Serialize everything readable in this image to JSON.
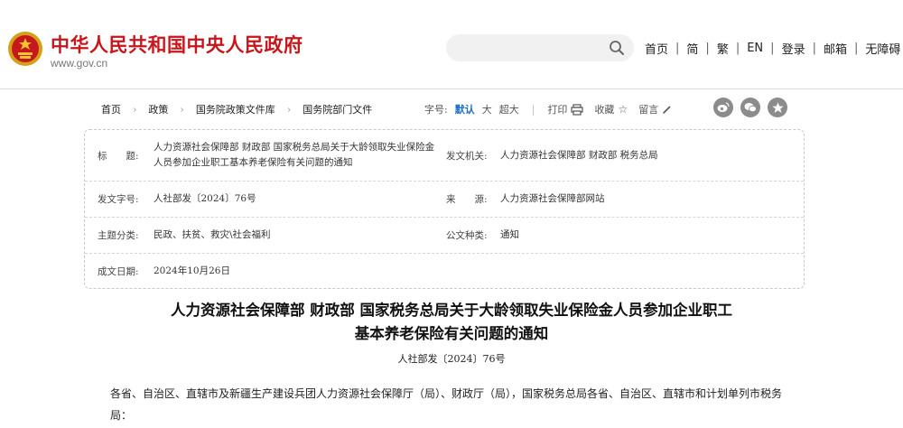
{
  "header": {
    "site_title": "中华人民共和国中央人民政府",
    "site_url": "www.gov.cn",
    "search_placeholder": "",
    "nav": [
      "首页",
      "简",
      "繁",
      "EN",
      "登录",
      "邮箱",
      "无障碍"
    ]
  },
  "breadcrumb": [
    "首页",
    "政策",
    "国务院政策文件库",
    "国务院部门文件"
  ],
  "tools": {
    "font_label": "字号:",
    "font_default": "默认",
    "font_large": "大",
    "font_xlarge": "超大",
    "print": "打印",
    "favorite": "收藏",
    "comment": "留言"
  },
  "info": {
    "title_label": "标　　题:",
    "title_value": "人力资源社会保障部 财政部 国家税务总局关于大龄领取失业保险金人员参加企业职工基本养老保险有关问题的通知",
    "issuer_label": "发文机关:",
    "issuer_value": "人力资源社会保障部 财政部 税务总局",
    "docno_label": "发文字号:",
    "docno_value": "人社部发〔2024〕76号",
    "source_label": "来　　源:",
    "source_value": "人力资源社会保障部网站",
    "category_label": "主题分类:",
    "category_value": "民政、扶贫、救灾\\社会福利",
    "doctype_label": "公文种类:",
    "doctype_value": "通知",
    "date_label": "成文日期:",
    "date_value": "2024年10月26日"
  },
  "article": {
    "title_line1": "人力资源社会保障部 财政部 国家税务总局关于大龄领取失业保险金人员参加企业职工",
    "title_line2": "基本养老保险有关问题的通知",
    "doc_number": "人社部发〔2024〕76号",
    "first_paragraph": "各省、自治区、直辖市及新疆生产建设兵团人力资源社会保障厅（局）、财政厅（局），国家税务总局各省、自治区、直辖市和计划单列市税务局："
  },
  "colors": {
    "brand_red": "#c8161d",
    "accent_blue": "#1f6fc3"
  }
}
